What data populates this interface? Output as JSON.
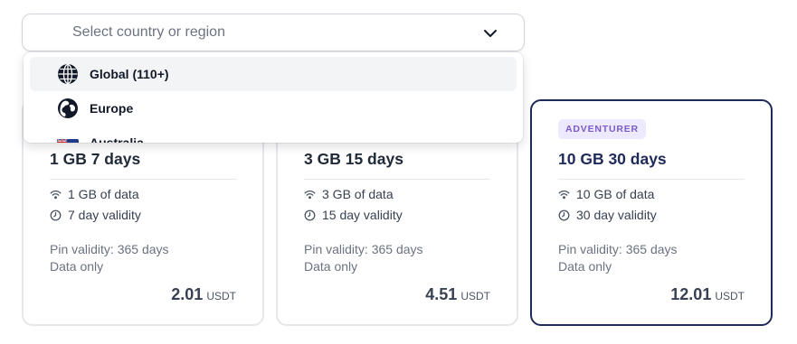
{
  "country_select": {
    "placeholder": "Select country or region",
    "options": [
      {
        "label": "Global (110+)",
        "icon": "globe-icon"
      },
      {
        "label": "Europe",
        "icon": "europe-globe-icon"
      },
      {
        "label": "Australia",
        "icon": "australia-flag-icon"
      }
    ]
  },
  "plans": [
    {
      "title": "1 GB 7 days",
      "data": "1 GB of data",
      "validity": "7 day validity",
      "pin_validity": "Pin validity: 365 days",
      "type": "Data only",
      "price": "2.01",
      "currency": "USDT"
    },
    {
      "title": "3 GB 15 days",
      "data": "3 GB of data",
      "validity": "15 day validity",
      "pin_validity": "Pin validity: 365 days",
      "type": "Data only",
      "price": "4.51",
      "currency": "USDT"
    },
    {
      "title": "10 GB 30 days",
      "badge": "ADVENTURER",
      "data": "10 GB of data",
      "validity": "30 day validity",
      "pin_validity": "Pin validity: 365 days",
      "type": "Data only",
      "price": "12.01",
      "currency": "USDT",
      "selected": true
    }
  ],
  "colors": {
    "selected_border": "#1e2a5a",
    "badge_bg": "#ede9fe",
    "badge_text": "#7c5cc4"
  }
}
